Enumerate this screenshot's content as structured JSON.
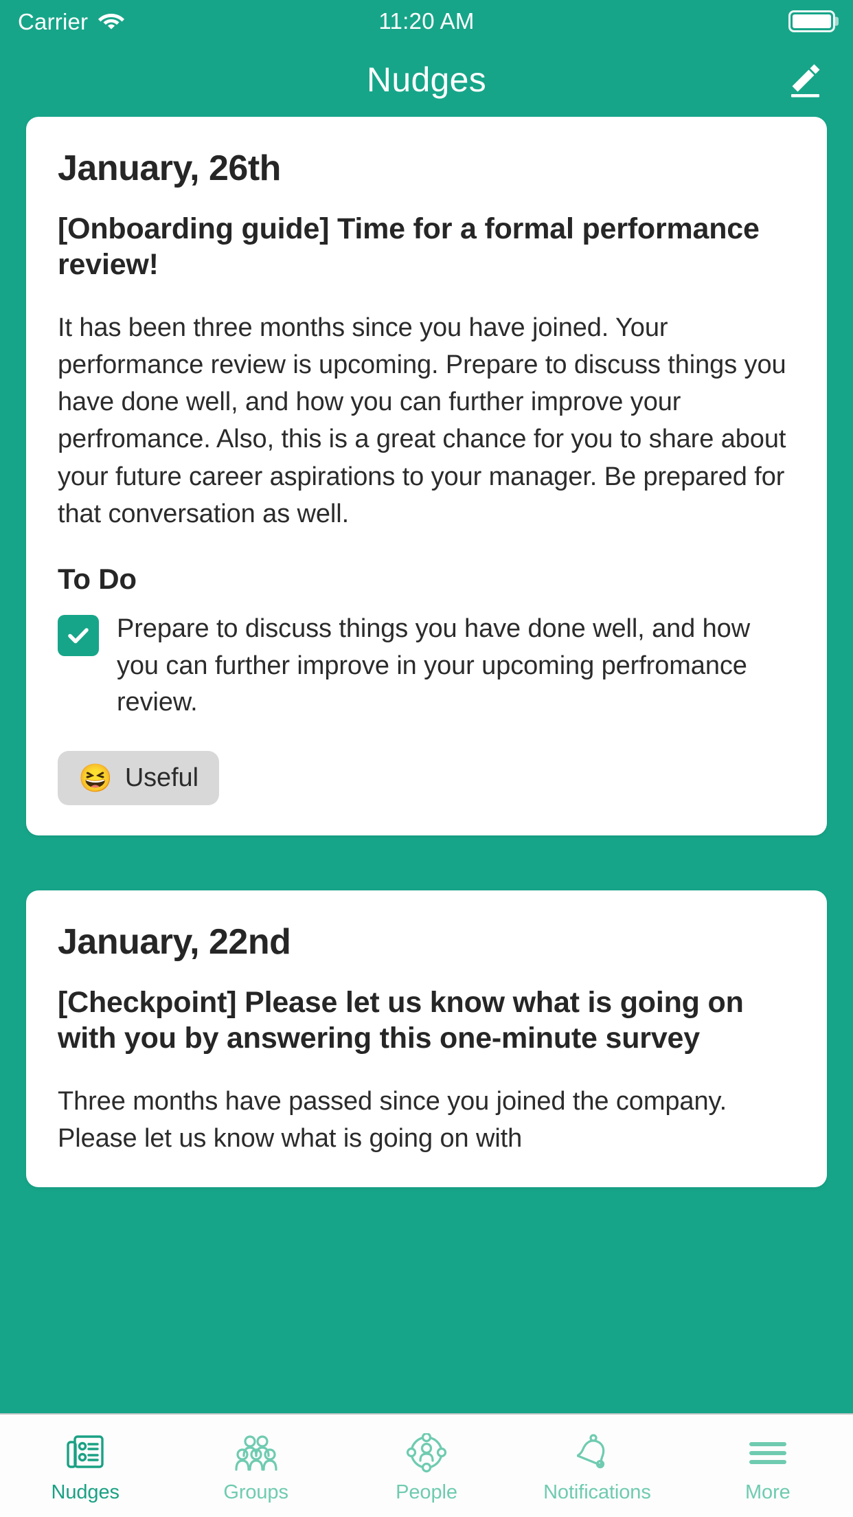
{
  "theme": {
    "brand_teal": "#17A589",
    "tab_active": "#1aa184",
    "tab_inactive": "#6fcbb0",
    "card_bg": "#ffffff",
    "reaction_pill_bg": "#d8d8d8"
  },
  "status_bar": {
    "carrier": "Carrier",
    "wifi_icon": "wifi-icon",
    "time": "11:20 AM",
    "battery_icon": "battery-full-icon"
  },
  "nav_bar": {
    "title": "Nudges",
    "edit_icon": "pencil-edit-icon"
  },
  "cards": [
    {
      "date": "January, 26th",
      "title": "[Onboarding guide] Time for a formal performance review!",
      "body": "It has been three months since you have joined. Your performance review is upcoming. Prepare to discuss things you have done well, and how you can further improve your perfromance. Also, this is a great chance for you to share about your future career aspirations to your manager. Be prepared for that conversation as well.",
      "todo_heading": "To Do",
      "todo_items": [
        {
          "checked": true,
          "text": "Prepare to discuss things you have done well, and how you can further improve in your upcoming perfromance review."
        }
      ],
      "reactions": [
        {
          "emoji": "😆",
          "emoji_name": "laughing-squinting-face-emoji",
          "label": "Useful"
        }
      ]
    },
    {
      "date": "January, 22nd",
      "title": "[Checkpoint] Please let us know what is going on with you by answering this one-minute survey",
      "body": "Three months have passed since you joined the company. Please let us know what is going on with"
    }
  ],
  "tab_bar": {
    "items": [
      {
        "label": "Nudges",
        "icon": "document-list-icon",
        "active": true
      },
      {
        "label": "Groups",
        "icon": "people-group-icon",
        "active": false
      },
      {
        "label": "People",
        "icon": "person-network-icon",
        "active": false
      },
      {
        "label": "Notifications",
        "icon": "bell-icon",
        "active": false
      },
      {
        "label": "More",
        "icon": "hamburger-menu-icon",
        "active": false
      }
    ]
  }
}
